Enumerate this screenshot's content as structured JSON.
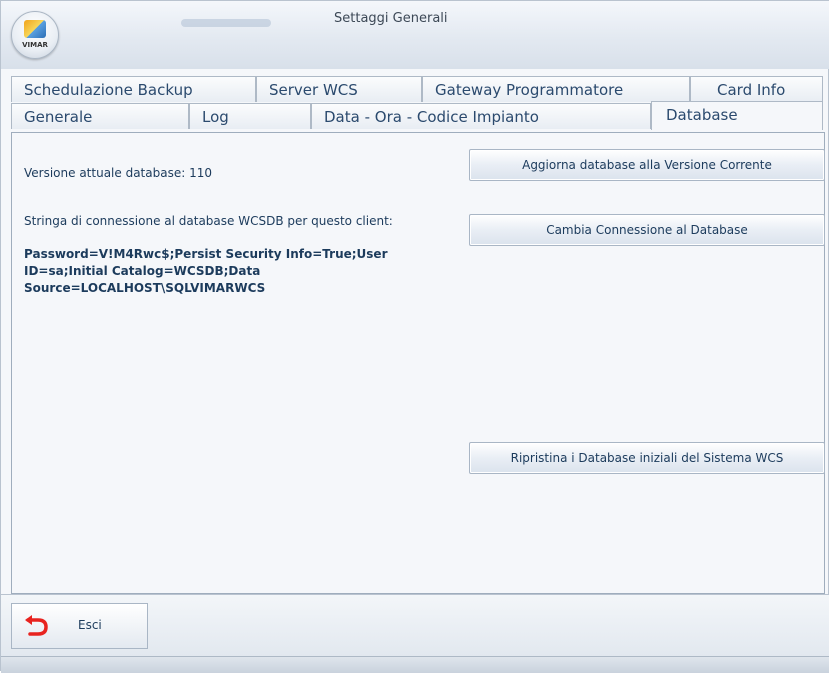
{
  "window": {
    "title": "Settaggi Generali",
    "logo_text": "VIMAR"
  },
  "tabs": {
    "row1": [
      "Schedulazione Backup",
      "Server WCS",
      "Gateway Programmatore",
      "Card Info"
    ],
    "row2": [
      "Generale",
      "Log",
      "Data - Ora - Codice Impianto",
      "Database"
    ],
    "active": "Database"
  },
  "database": {
    "version_label": "Versione attuale database:",
    "version_value": "110",
    "connection_label": "Stringa di connessione al database WCSDB per questo client:",
    "connection_string_lines": [
      "Password=V!M4Rwc$;Persist Security Info=True;User",
      "ID=sa;Initial Catalog=WCSDB;Data",
      "Source=LOCALHOST\\SQLVIMARWCS"
    ],
    "buttons": {
      "update": "Aggiorna database alla Versione Corrente",
      "change_connection": "Cambia Connessione al Database",
      "restore": "Ripristina i Database iniziali del Sistema WCS"
    }
  },
  "footer": {
    "exit_label": "Esci",
    "exit_icon": "back-arrow-icon",
    "exit_icon_color": "#e8231f"
  }
}
